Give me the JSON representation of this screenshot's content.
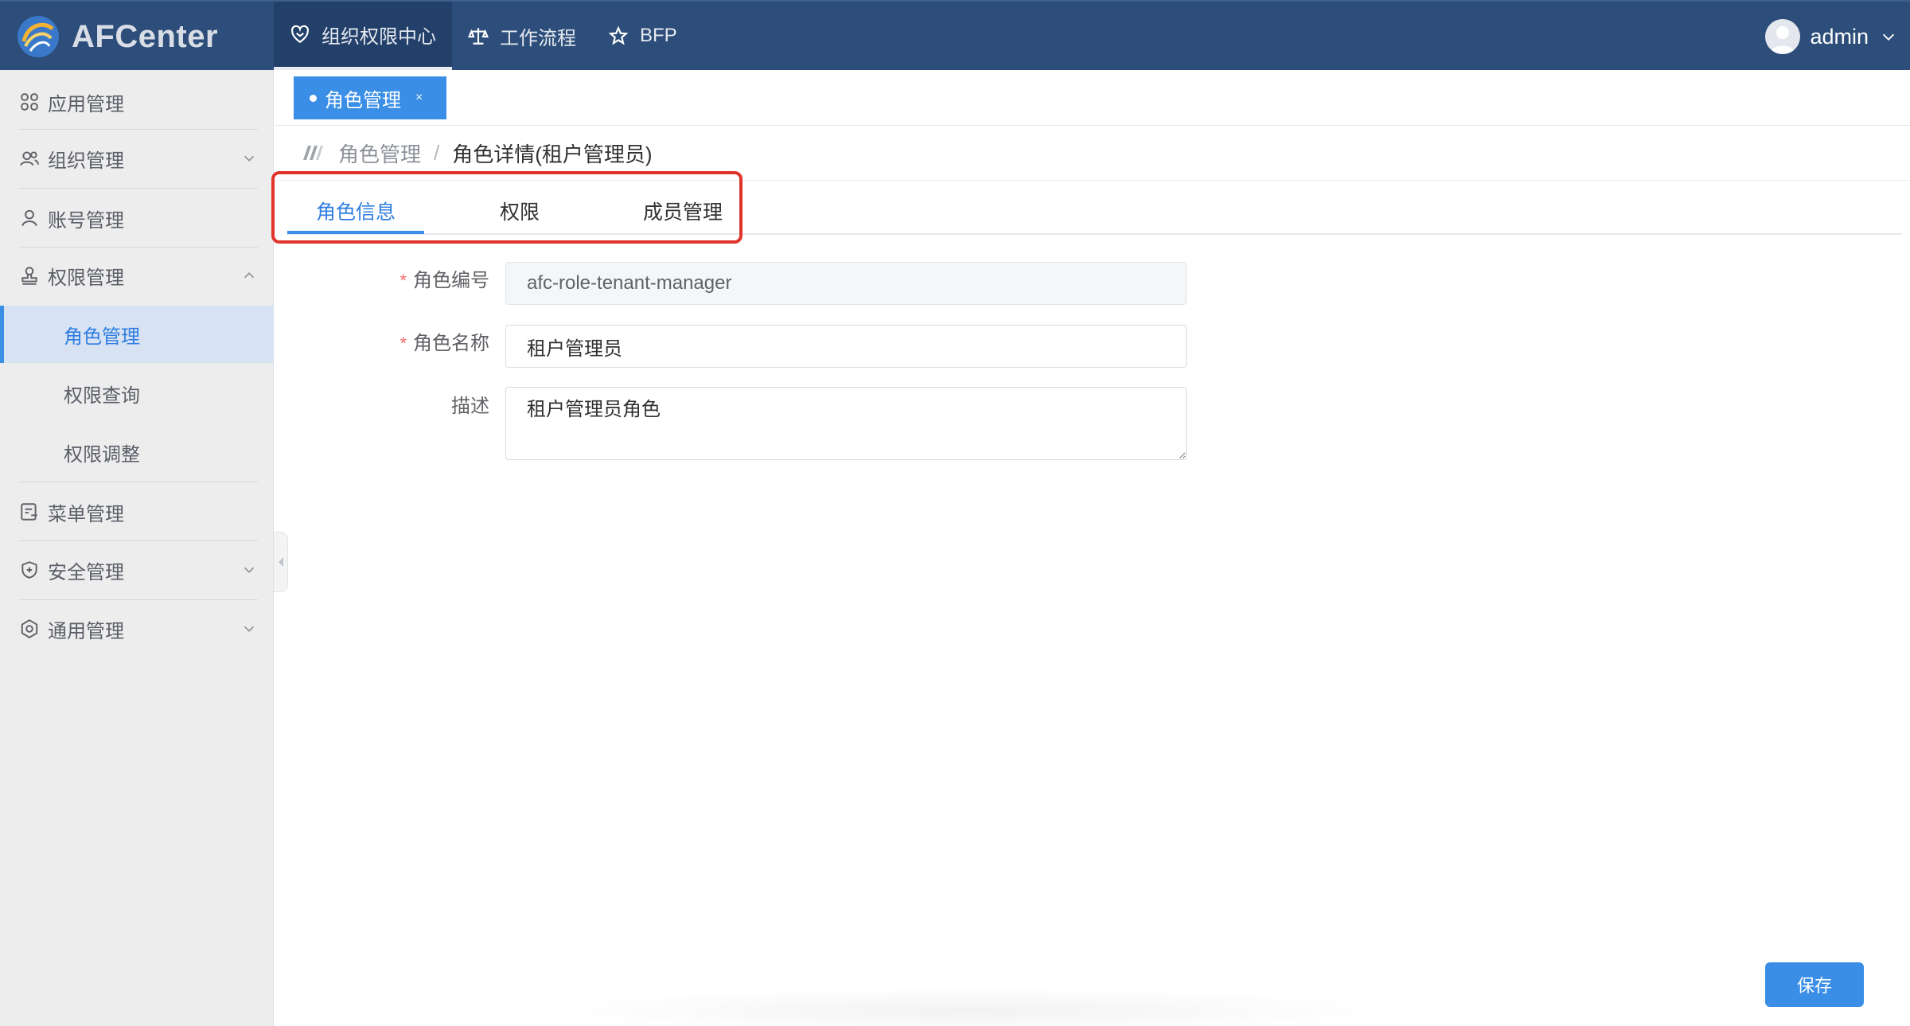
{
  "app": {
    "logo_text": "AFCenter"
  },
  "topnav": {
    "items": [
      {
        "label": "组织权限中心",
        "icon": "heart-shield-icon",
        "active": true
      },
      {
        "label": "工作流程",
        "icon": "scale-icon",
        "active": false
      },
      {
        "label": "BFP",
        "icon": "star-icon",
        "active": false
      }
    ],
    "user": {
      "name": "admin"
    }
  },
  "sidebar": {
    "items": [
      {
        "label": "应用管理",
        "icon": "apps-grid-icon"
      },
      {
        "label": "组织管理",
        "icon": "users-icon",
        "expanded": false
      },
      {
        "label": "账号管理",
        "icon": "user-icon"
      },
      {
        "label": "权限管理",
        "icon": "stamp-icon",
        "expanded": true
      },
      {
        "label": "菜单管理",
        "icon": "document-icon"
      },
      {
        "label": "安全管理",
        "icon": "shield-plus-icon",
        "expanded": false
      },
      {
        "label": "通用管理",
        "icon": "settings-icon",
        "expanded": false
      }
    ],
    "subitems": [
      {
        "label": "角色管理",
        "active": true
      },
      {
        "label": "权限查询",
        "active": false
      },
      {
        "label": "权限调整",
        "active": false
      }
    ]
  },
  "tagbar": {
    "tags": [
      {
        "label": "角色管理",
        "close": "×"
      }
    ]
  },
  "breadcrumb": {
    "parent": "角色管理",
    "separator": "/",
    "current": "角色详情(租户管理员)"
  },
  "tabs": [
    {
      "label": "角色信息",
      "active": true
    },
    {
      "label": "权限",
      "active": false
    },
    {
      "label": "成员管理",
      "active": false
    }
  ],
  "form": {
    "required_mark": "*",
    "role_code": {
      "label": "角色编号",
      "value": "afc-role-tenant-manager",
      "disabled": true
    },
    "role_name": {
      "label": "角色名称",
      "value": "租户管理员"
    },
    "description": {
      "label": "描述",
      "value": "租户管理员角色"
    }
  },
  "actions": {
    "save_label": "保存"
  },
  "colors": {
    "topbar": "#2d4e7a",
    "accent": "#3a8ee6",
    "highlight_border": "#e0342a",
    "sidebar_bg": "#ededee",
    "required": "#f56c6c"
  }
}
